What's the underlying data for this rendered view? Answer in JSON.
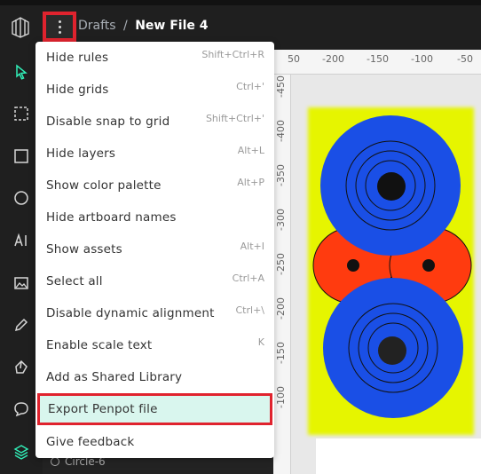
{
  "breadcrumb": {
    "project": "Drafts",
    "separator": "/",
    "file": "New File 4"
  },
  "rulers": {
    "top": [
      "50",
      "-200",
      "-150",
      "-100",
      "-50"
    ],
    "left": [
      "-450",
      "-400",
      "-350",
      "-300",
      "-250",
      "-200",
      "-150",
      "-100"
    ]
  },
  "menu": {
    "items": [
      {
        "label": "Hide rules",
        "shortcut": "Shift+Ctrl+R"
      },
      {
        "label": "Hide grids",
        "shortcut": "Ctrl+'"
      },
      {
        "label": "Disable snap to grid",
        "shortcut": "Shift+Ctrl+'"
      },
      {
        "label": "Hide layers",
        "shortcut": "Alt+L"
      },
      {
        "label": "Show color palette",
        "shortcut": "Alt+P"
      },
      {
        "label": "Hide artboard names",
        "shortcut": ""
      },
      {
        "label": "Show assets",
        "shortcut": "Alt+I"
      },
      {
        "label": "Select all",
        "shortcut": "Ctrl+A"
      },
      {
        "label": "Disable dynamic alignment",
        "shortcut": "Ctrl+\\"
      },
      {
        "label": "Enable scale text",
        "shortcut": "K"
      },
      {
        "label": "Add as Shared Library",
        "shortcut": ""
      },
      {
        "label": "Export Penpot file",
        "shortcut": ""
      },
      {
        "label": "Give feedback",
        "shortcut": ""
      }
    ]
  },
  "layers": {
    "visible_item": "Circle-6"
  },
  "colors": {
    "artboard": "#e6f500",
    "blue": "#1a4fe6",
    "red": "#ff3b0f",
    "dark": "#1f1f1f",
    "highlight_outline": "#e0232e",
    "highlight_fill": "#d9f6ee"
  }
}
